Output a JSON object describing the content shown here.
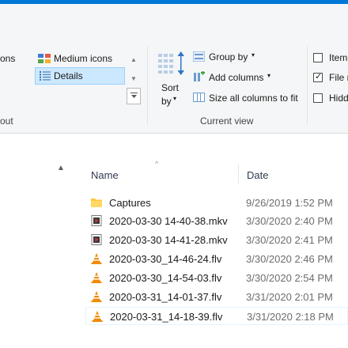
{
  "ribbon": {
    "layout": {
      "icons_label_partial": "ons",
      "medium_icons": "Medium icons",
      "details": "Details",
      "group_label_partial": "out"
    },
    "current_view": {
      "sort_by_line1": "Sort",
      "sort_by_line2": "by",
      "group_by": "Group by",
      "add_columns": "Add columns",
      "size_all_columns": "Size all columns to fit",
      "group_label": "Current view"
    },
    "show_hide": {
      "item_partial": "Item",
      "file_partial": "File n",
      "hidden_partial": "Hidd",
      "item_checked": false,
      "file_checked": true,
      "hidden_checked": false
    }
  },
  "file_list": {
    "columns": {
      "name": "Name",
      "date": "Date"
    },
    "rows": [
      {
        "name": "Captures",
        "date": "9/26/2019 1:52 PM",
        "icon": "folder-icon"
      },
      {
        "name": "2020-03-30 14-40-38.mkv",
        "date": "3/30/2020 2:40 PM",
        "icon": "video-file-icon"
      },
      {
        "name": "2020-03-30 14-41-28.mkv",
        "date": "3/30/2020 2:41 PM",
        "icon": "video-file-icon"
      },
      {
        "name": "2020-03-30_14-46-24.flv",
        "date": "3/30/2020 2:46 PM",
        "icon": "vlc-icon"
      },
      {
        "name": "2020-03-30_14-54-03.flv",
        "date": "3/30/2020 2:54 PM",
        "icon": "vlc-icon"
      },
      {
        "name": "2020-03-31_14-01-37.flv",
        "date": "3/31/2020 2:01 PM",
        "icon": "vlc-icon"
      },
      {
        "name": "2020-03-31_14-18-39.flv",
        "date": "3/31/2020 2:18 PM",
        "icon": "vlc-icon"
      }
    ]
  },
  "colors": {
    "accent": "#0078d7",
    "selection_bg": "#cce8ff",
    "selection_border": "#99d1ff",
    "folder": "#ffc83d",
    "vlc_orange": "#f18a00"
  }
}
